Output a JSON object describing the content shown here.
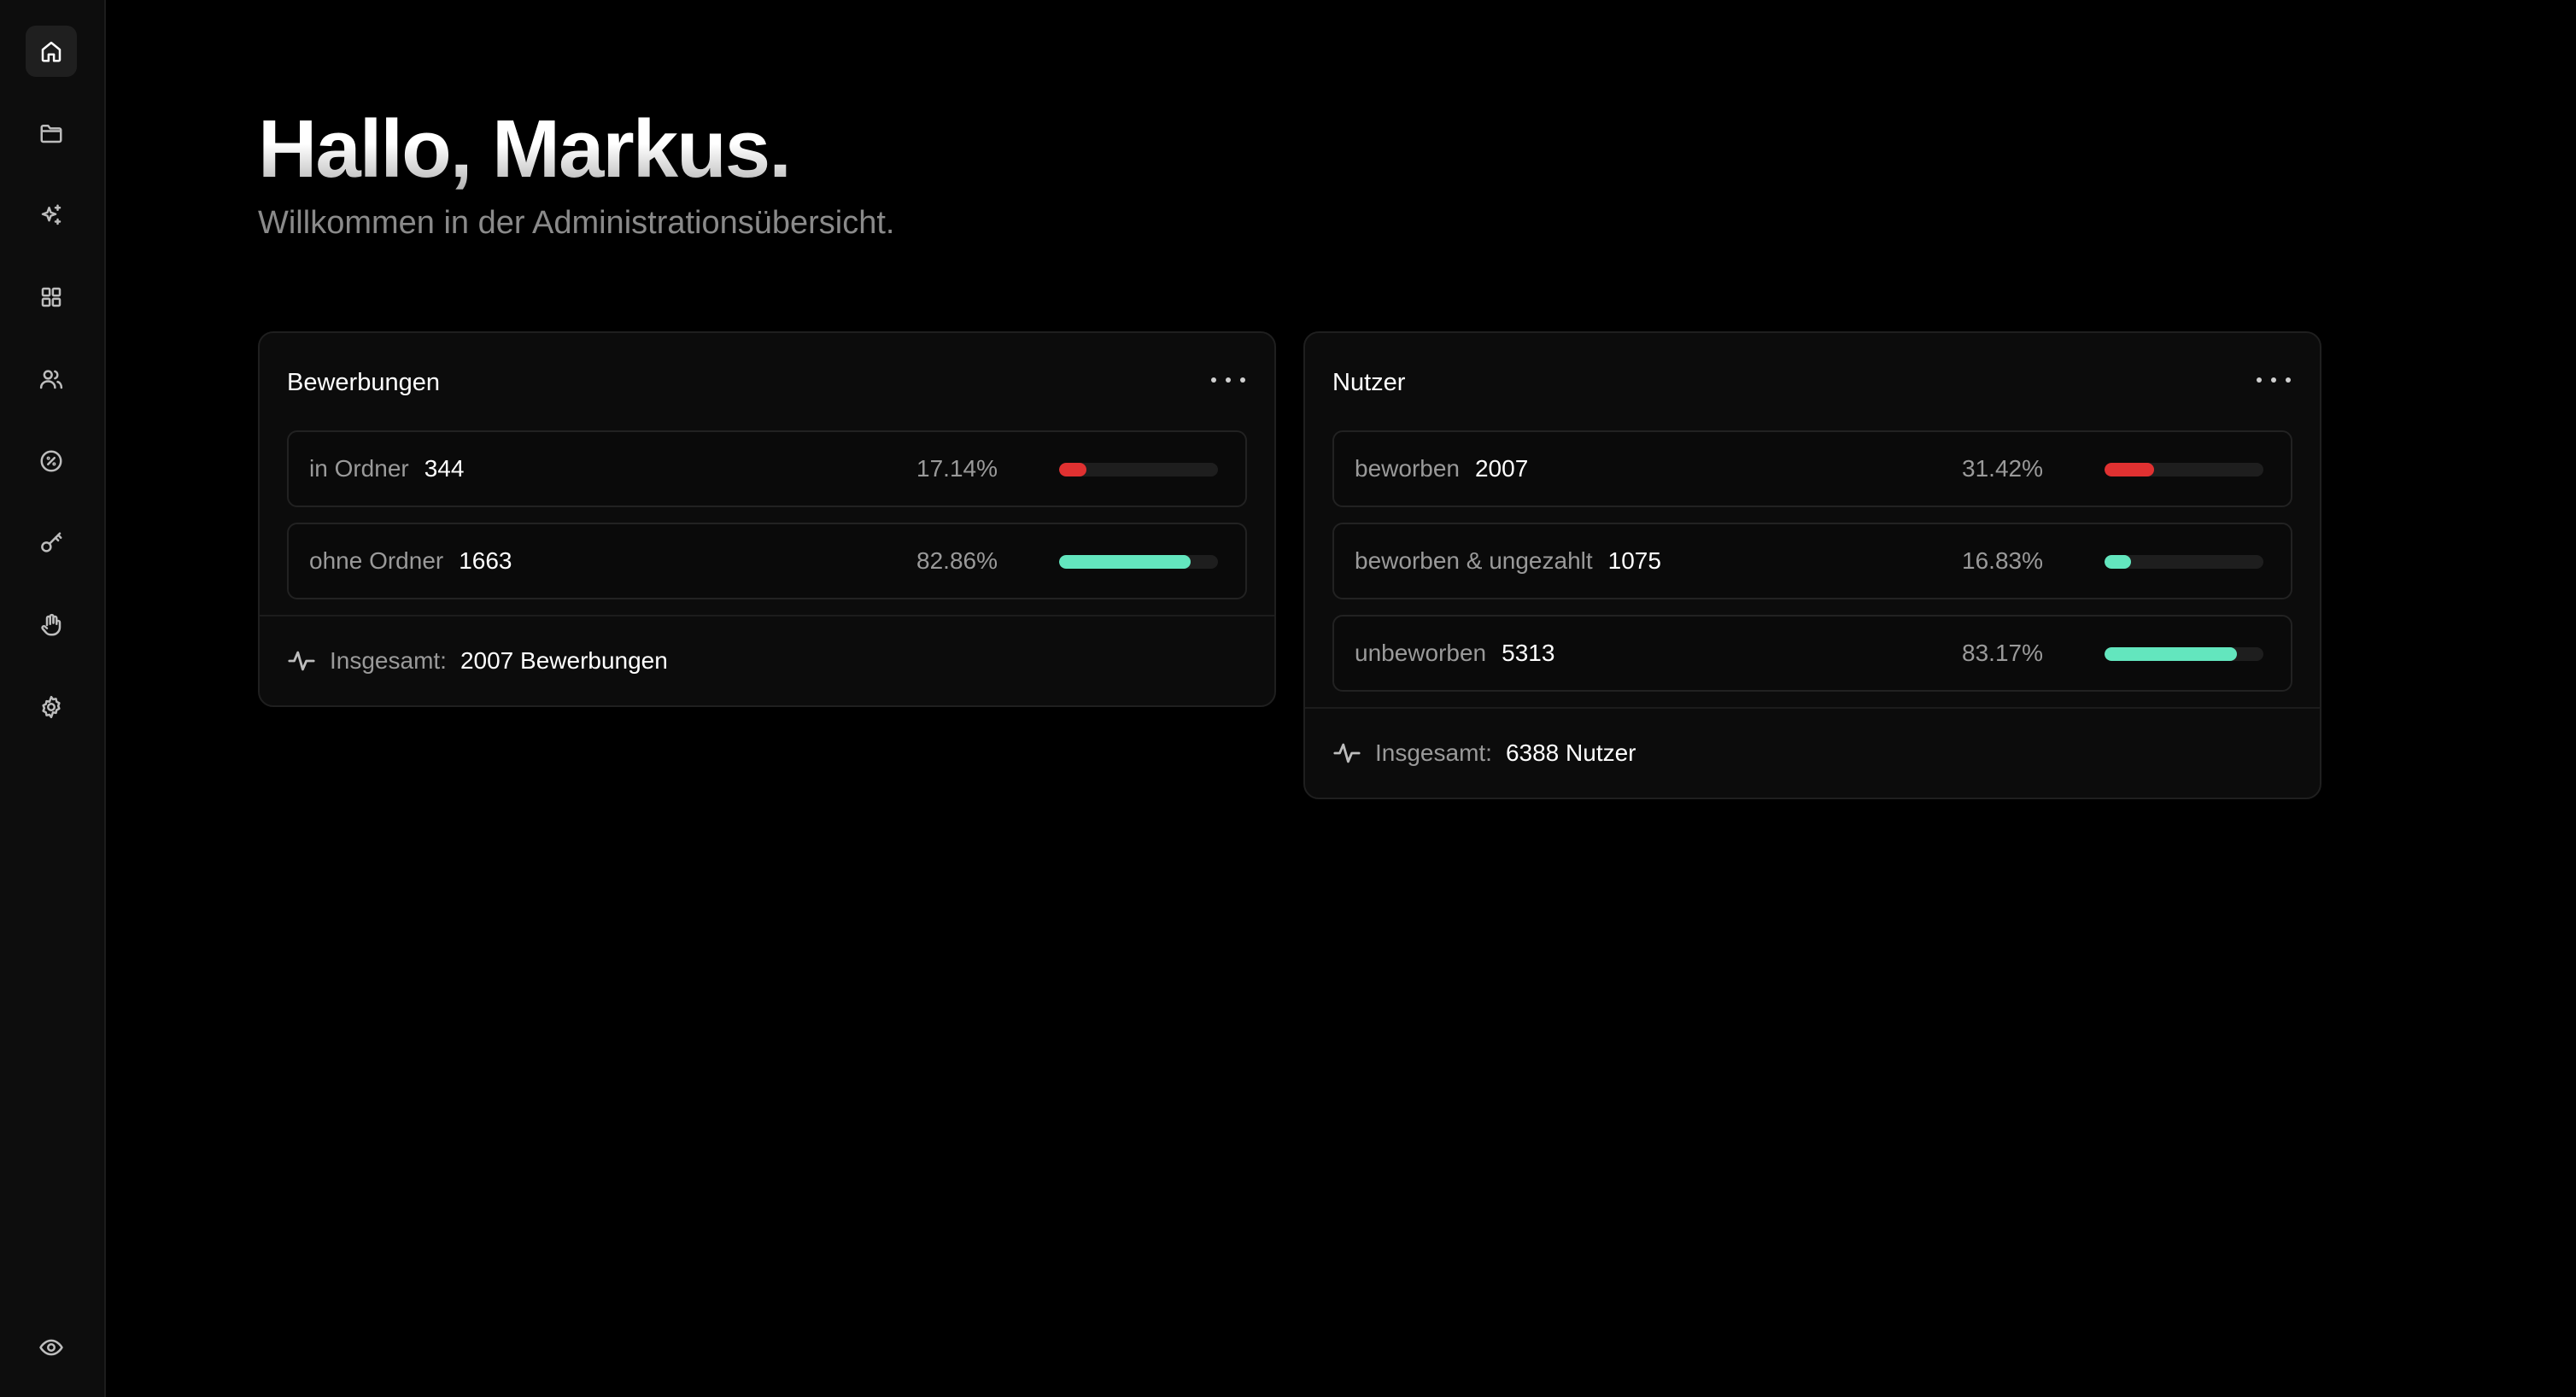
{
  "header": {
    "greeting": "Hallo, Markus.",
    "subtitle": "Willkommen in der Administrationsübersicht."
  },
  "sidebar": {
    "items": [
      {
        "icon": "home-icon",
        "active": true
      },
      {
        "icon": "folder-icon"
      },
      {
        "icon": "sparkles-icon"
      },
      {
        "icon": "grid-icon"
      },
      {
        "icon": "users-icon"
      },
      {
        "icon": "percent-badge-icon"
      },
      {
        "icon": "key-icon"
      },
      {
        "icon": "hand-icon"
      },
      {
        "icon": "gear-icon"
      }
    ],
    "bottom_icon": "eye-icon"
  },
  "colors": {
    "low": "#e03131",
    "high": "#63e6be"
  },
  "cards": [
    {
      "title": "Bewerbungen",
      "rows": [
        {
          "label": "in Ordner",
          "count": "344",
          "percent": "17.14%",
          "fraction": 0.1714,
          "color": "#e03131"
        },
        {
          "label": "ohne Ordner",
          "count": "1663",
          "percent": "82.86%",
          "fraction": 0.8286,
          "color": "#63e6be"
        }
      ],
      "footer_label": "Insgesamt:",
      "footer_value": "2007 Bewerbungen"
    },
    {
      "title": "Nutzer",
      "rows": [
        {
          "label": "beworben",
          "count": "2007",
          "percent": "31.42%",
          "fraction": 0.3142,
          "color": "#e03131"
        },
        {
          "label": "beworben & ungezahlt",
          "count": "1075",
          "percent": "16.83%",
          "fraction": 0.1683,
          "color": "#63e6be"
        },
        {
          "label": "unbeworben",
          "count": "5313",
          "percent": "83.17%",
          "fraction": 0.8317,
          "color": "#63e6be"
        }
      ],
      "footer_label": "Insgesamt:",
      "footer_value": "6388 Nutzer"
    }
  ]
}
